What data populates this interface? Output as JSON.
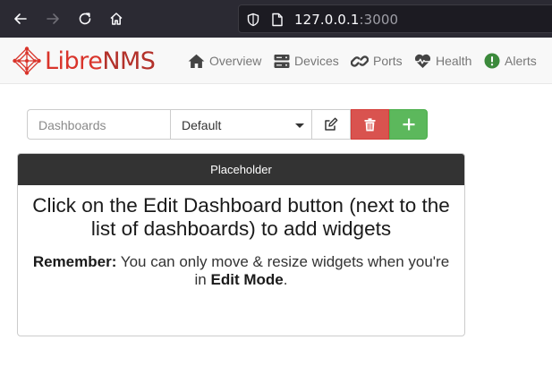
{
  "browser": {
    "url_host": "127.0.0.1",
    "url_port": ":3000"
  },
  "navbar": {
    "brand_libre": "Libre",
    "brand_nms": "NMS",
    "items": [
      {
        "label": "Overview",
        "icon": "home-icon"
      },
      {
        "label": "Devices",
        "icon": "server-icon"
      },
      {
        "label": "Ports",
        "icon": "link-icon"
      },
      {
        "label": "Health",
        "icon": "heartbeat-icon"
      },
      {
        "label": "Alerts",
        "icon": "exclamation-circle-icon"
      }
    ]
  },
  "dashboard": {
    "label": "Dashboards",
    "selected": "Default",
    "add_label": "+"
  },
  "widget": {
    "title": "Placeholder",
    "message": "Click on the Edit Dashboard button (next to the list of dashboards) to add widgets",
    "note_strong": "Remember:",
    "note_text": " You can only move & resize widgets when you're in ",
    "note_mode": "Edit Mode",
    "note_end": "."
  },
  "colors": {
    "brand_red": "#d9342b",
    "delete_red": "#d9534f",
    "add_green": "#5cb85c",
    "widget_header": "#333333",
    "browser_bg": "#2b2a33"
  }
}
